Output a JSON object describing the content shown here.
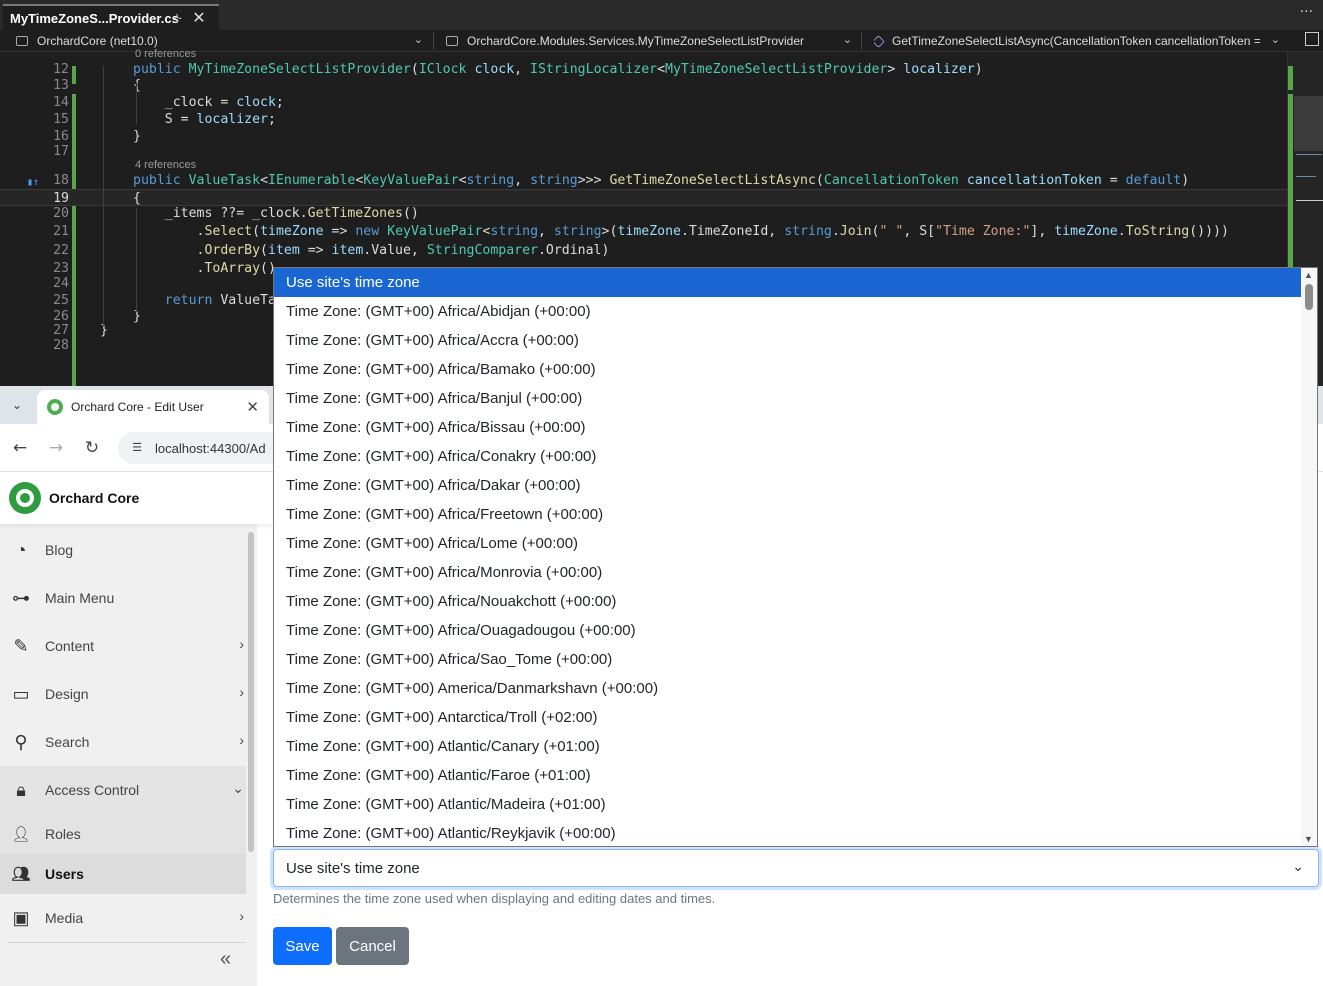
{
  "ide": {
    "tab_title": "MyTimeZoneS...Provider.cs",
    "pin_glyph": "⊹",
    "close_glyph": "✕",
    "more_glyph": "···",
    "nav": {
      "project": "OrchardCore (net10.0)",
      "class": "OrchardCore.Modules.Services.MyTimeZoneSelectListProvider",
      "member": "GetTimeZoneSelectListAsync(CancellationToken cancellationToken = "
    },
    "codelens_top": "0 references",
    "codelens_method": "4 references",
    "line_numbers": [
      "12",
      "13",
      "14",
      "15",
      "16",
      "17",
      "18",
      "19",
      "20",
      "21",
      "22",
      "23",
      "24",
      "25",
      "26",
      "27",
      "28"
    ]
  },
  "browser": {
    "tab_title": "Orchard Core - Edit User",
    "url": "localhost:44300/Ad"
  },
  "admin": {
    "brand": "Orchard Core",
    "menu": [
      {
        "label": "Blog",
        "icon": "rss-icon"
      },
      {
        "label": "Main Menu",
        "icon": "sitemap-icon"
      },
      {
        "label": "Content",
        "icon": "edit-icon"
      },
      {
        "label": "Design",
        "icon": "monitor-icon"
      },
      {
        "label": "Search",
        "icon": "search-icon"
      },
      {
        "label": "Access Control",
        "icon": "lock-icon"
      },
      {
        "label": "Roles",
        "icon": "user-shield-icon"
      },
      {
        "label": "Users",
        "icon": "users-icon"
      },
      {
        "label": "Media",
        "icon": "images-icon"
      }
    ],
    "collapse_glyph": "«"
  },
  "form": {
    "timezone_selected": "Use site's time zone",
    "timezone_hint": "Determines the time zone used when displaying and editing dates and times.",
    "save_label": "Save",
    "cancel_label": "Cancel",
    "timezone_options": [
      "Use site's time zone",
      "Time Zone: (GMT+00) Africa/Abidjan (+00:00)",
      "Time Zone: (GMT+00) Africa/Accra (+00:00)",
      "Time Zone: (GMT+00) Africa/Bamako (+00:00)",
      "Time Zone: (GMT+00) Africa/Banjul (+00:00)",
      "Time Zone: (GMT+00) Africa/Bissau (+00:00)",
      "Time Zone: (GMT+00) Africa/Conakry (+00:00)",
      "Time Zone: (GMT+00) Africa/Dakar (+00:00)",
      "Time Zone: (GMT+00) Africa/Freetown (+00:00)",
      "Time Zone: (GMT+00) Africa/Lome (+00:00)",
      "Time Zone: (GMT+00) Africa/Monrovia (+00:00)",
      "Time Zone: (GMT+00) Africa/Nouakchott (+00:00)",
      "Time Zone: (GMT+00) Africa/Ouagadougou (+00:00)",
      "Time Zone: (GMT+00) Africa/Sao_Tome (+00:00)",
      "Time Zone: (GMT+00) America/Danmarkshavn (+00:00)",
      "Time Zone: (GMT+00) Antarctica/Troll (+02:00)",
      "Time Zone: (GMT+00) Atlantic/Canary (+01:00)",
      "Time Zone: (GMT+00) Atlantic/Faroe (+01:00)",
      "Time Zone: (GMT+00) Atlantic/Madeira (+01:00)",
      "Time Zone: (GMT+00) Atlantic/Reykjavik (+00:00)"
    ]
  },
  "colors": {
    "ide_bg": "#1e1e1e",
    "keyword": "#569cd6",
    "type": "#4ec9b0",
    "method": "#dcdcaa",
    "param": "#9cdcfe",
    "string": "#d69d85",
    "selected_option": "#1a66d2",
    "primary": "#0d6efd",
    "secondary": "#6c757d"
  }
}
